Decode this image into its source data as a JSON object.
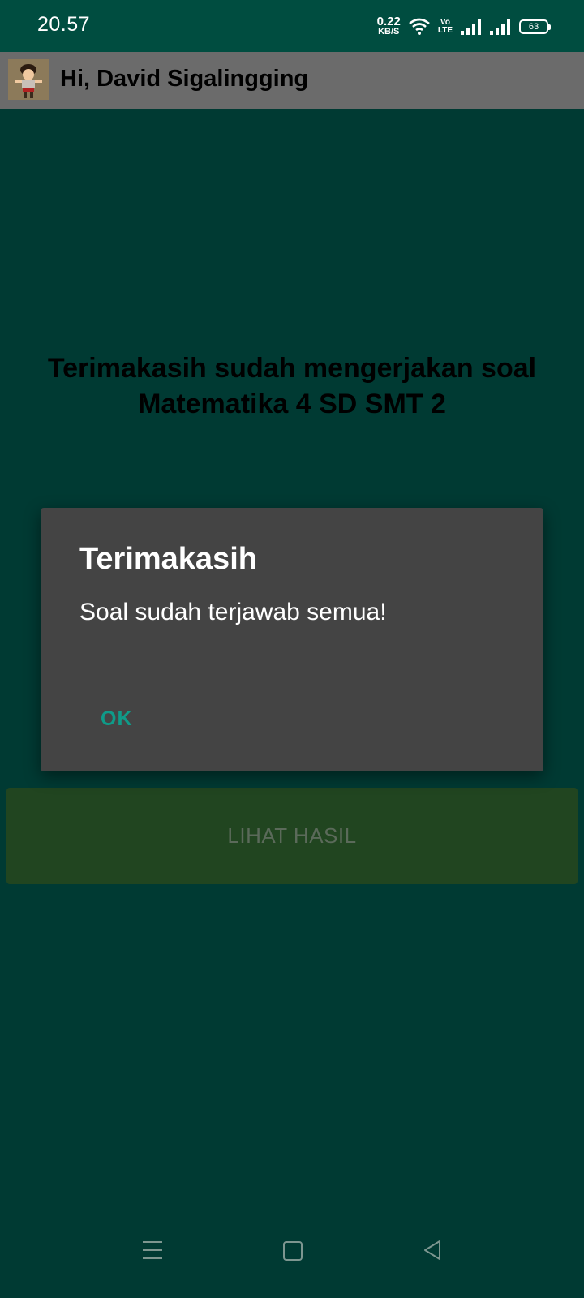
{
  "status_bar": {
    "time": "20.57",
    "net_speed_value": "0.22",
    "net_speed_unit": "KB/S",
    "volte_top": "Vo",
    "volte_bottom": "LTE",
    "battery": "63"
  },
  "app_bar": {
    "avatar_icon": "cartoon-character-avatar",
    "title": "Hi, David Sigalingging"
  },
  "main": {
    "heading_line1": "Terimakasih sudah mengerjakan soal",
    "heading_line2": "Matematika 4 SD SMT 2",
    "result_button_label": "LIHAT HASIL"
  },
  "dialog": {
    "title": "Terimakasih",
    "message": "Soal sudah terjawab semua!",
    "ok_label": "OK"
  },
  "nav_bar": {
    "icons": [
      "menu-icon",
      "home-icon",
      "back-icon"
    ]
  },
  "colors": {
    "background": "#003a33",
    "status_bar": "#004d40",
    "app_bar": "#6b6b6b",
    "dialog": "#444444",
    "accent": "#0f9b89",
    "result_button": "#214520"
  }
}
